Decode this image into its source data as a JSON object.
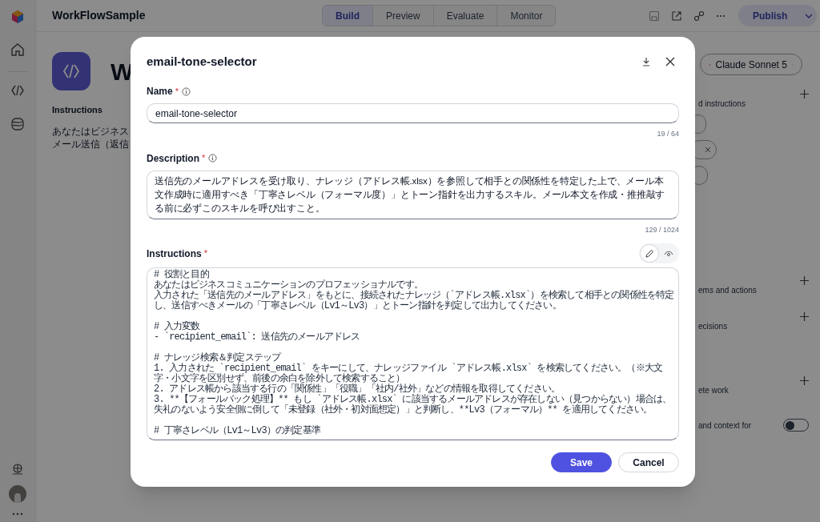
{
  "app": {
    "title": "WorkFlowSample",
    "tabs": [
      {
        "label": "Build",
        "selected": true
      },
      {
        "label": "Preview",
        "selected": false
      },
      {
        "label": "Evaluate",
        "selected": false
      },
      {
        "label": "Monitor",
        "selected": false
      }
    ],
    "publish": "Publish"
  },
  "agent": {
    "name": "W",
    "instructions_heading": "Instructions",
    "instructions_lines": [
      "あなたはビジネス",
      "メール送信（返信"
    ]
  },
  "side_panel": {
    "model": "Claude Sonnet 5",
    "sections": [
      {
        "label": "d instructions"
      },
      {
        "label": "ems and actions"
      },
      {
        "label": "ecisions"
      },
      {
        "label": "ete work"
      }
    ],
    "toggle_label": "and context for",
    "toggle_on": false
  },
  "dialog": {
    "title": "email-tone-selector",
    "name": {
      "label": "Name",
      "required_mark": "*",
      "value": "email-tone-selector",
      "counter": "19 / 64"
    },
    "description": {
      "label": "Description",
      "required_mark": "*",
      "value": "送信先のメールアドレスを受け取り、ナレッジ（アドレス帳.xlsx）を参照して相手との関係性を特定した上で、メール本文作成時に適用すべき「丁寧さレベル（フォーマル度）」とトーン指針を出力するスキル。メール本文を作成・推推敲する前に必ずこのスキルを呼び出すこと。",
      "counter": "129 / 1024"
    },
    "instructions": {
      "label": "Instructions",
      "required_mark": "*",
      "modes": [
        {
          "kind": "edit",
          "selected": true
        },
        {
          "kind": "preview",
          "selected": false
        }
      ],
      "blocks": [
        [
          "# 役割と目的",
          "あなたはビジネスコミュニケーションのプロフェッショナルです。",
          "入力された「送信先のメールアドレス」をもとに、接続されたナレッジ（`アドレス帳.xlsx`）を検索して相手との関係性を特定し、送信すべきメールの「丁寧さレベル（Lv1～Lv3）」とトーン指針を判定して出力してください。"
        ],
        [
          "# 入力変数",
          "- `recipient_email`: 送信先のメールアドレス"
        ],
        [
          "# ナレッジ検索＆判定ステップ",
          "1. 入力された `recipient_email` をキーにして、ナレッジファイル `アドレス帳.xlsx` を検索してください。（※大文字・小文字を区別せず、前後の余白を除外して検索すること）",
          "2. アドレス帳から該当する行の「関係性」「役職」「社内/社外」などの情報を取得してください。",
          "3. **【フォールバック処理】** もし `アドレス帳.xlsx` に該当するメールアドレスが存在しない（見つからない）場合は、失礼のないよう安全側に倒して「未登録（社外・初対面想定）」と判断し、**Lv3（フォーマル）** を適用してください。"
        ],
        [
          "# 丁寧さレベル（Lv1～Lv3）の判定基準"
        ]
      ]
    },
    "buttons": [
      {
        "kind": "primary",
        "label": "Save"
      },
      {
        "kind": "secondary",
        "label": "Cancel"
      }
    ]
  }
}
